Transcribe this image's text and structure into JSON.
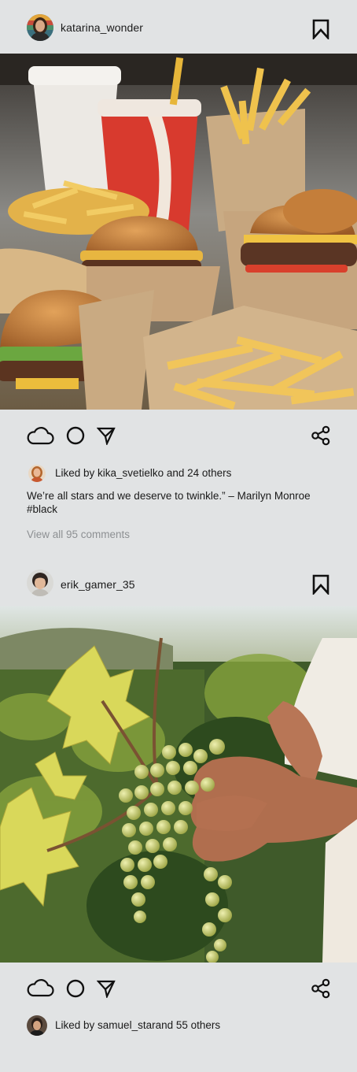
{
  "posts": [
    {
      "username": "katarina_wonder",
      "likes_prefix": "Liked by ",
      "likes_user": "kika_svetielko",
      "likes_suffix": " and 24 others",
      "caption": "We’re all stars and we deserve to twinkle.” – Marilyn Monroe #black",
      "view_comments": "View all 95 comments",
      "image": "fast-food-burgers-fries-photo"
    },
    {
      "username": "erik_gamer_35",
      "likes_prefix": "Liked by ",
      "likes_user": "samuel_star",
      "likes_suffix": "and 55 others",
      "image": "vineyard-grape-harvest-photo"
    }
  ],
  "icons": {
    "bookmark": "bookmark-icon",
    "like": "cloud-icon",
    "comment": "circle-icon",
    "send": "paper-plane-icon",
    "share": "share-icon"
  },
  "colors": {
    "background": "#e1e3e4",
    "text": "#1a1a1a",
    "muted": "#8d9093"
  }
}
